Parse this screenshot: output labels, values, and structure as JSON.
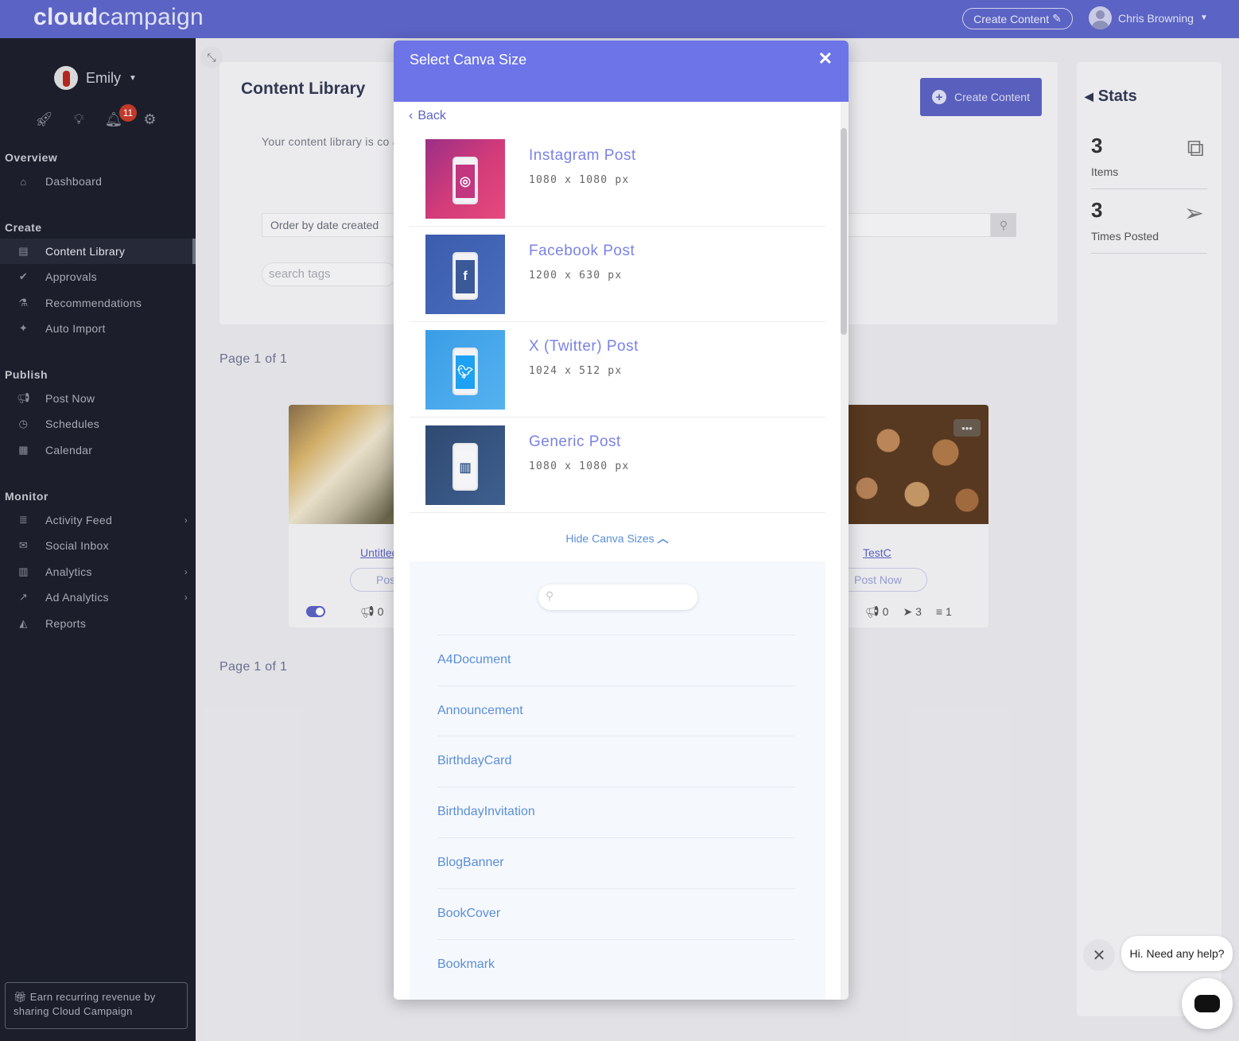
{
  "topbar": {
    "logo_bold": "cloud",
    "logo_light": "campaign",
    "create_content_label": "Create Content",
    "user_name": "Chris Browning"
  },
  "sidebar": {
    "user_name": "Emily",
    "notification_count": "11",
    "sections": {
      "overview": "Overview",
      "create": "Create",
      "publish": "Publish",
      "monitor": "Monitor"
    },
    "items": {
      "dashboard": "Dashboard",
      "content_library": "Content Library",
      "approvals": "Approvals",
      "recommendations": "Recommendations",
      "auto_import": "Auto Import",
      "post_now": "Post Now",
      "schedules": "Schedules",
      "calendar": "Calendar",
      "activity_feed": "Activity Feed",
      "social_inbox": "Social Inbox",
      "analytics": "Analytics",
      "ad_analytics": "Ad Analytics",
      "reports": "Reports"
    },
    "earn_text": "Earn recurring revenue by sharing Cloud Campaign"
  },
  "library": {
    "title": "Content Library",
    "description": "Your content library is co                                                                                       add to schedules, and more directly from the library.",
    "create_button": "Create Content",
    "order_select": "Order by date created",
    "tags_placeholder": "search tags",
    "page_info_top": "Page 1 of 1",
    "page_info_bottom": "Page 1 of 1"
  },
  "cards": [
    {
      "title": "Untitled",
      "post_label": "Pos",
      "posts": "0"
    },
    {
      "title": "TestC",
      "post_label": "Post Now",
      "posts": "0",
      "times_posted": "3",
      "items": "1"
    }
  ],
  "stats": {
    "title": "Stats",
    "items_count": "3",
    "items_label": "Items",
    "posted_count": "3",
    "posted_label": "Times Posted"
  },
  "modal": {
    "title": "Select Canva Size",
    "back_label": "Back",
    "sizes": [
      {
        "name": "Instagram Post",
        "dims": "1080 x 1080 px"
      },
      {
        "name": "Facebook Post",
        "dims": "1200 x 630 px"
      },
      {
        "name": "X (Twitter) Post",
        "dims": "1024 x 512 px"
      },
      {
        "name": "Generic Post",
        "dims": "1080 x 1080 px"
      }
    ],
    "hide_label": "Hide Canva Sizes",
    "canva_types": [
      "A4Document",
      "Announcement",
      "BirthdayCard",
      "BirthdayInvitation",
      "BlogBanner",
      "BookCover",
      "Bookmark"
    ]
  },
  "chat": {
    "greeting": "Hi. Need any help?"
  },
  "colors": {
    "brand": "#5b63c4",
    "modal_header": "#6c74e8",
    "sidebar_bg": "#1c1f2b",
    "link_blue": "#5b8fd9"
  }
}
